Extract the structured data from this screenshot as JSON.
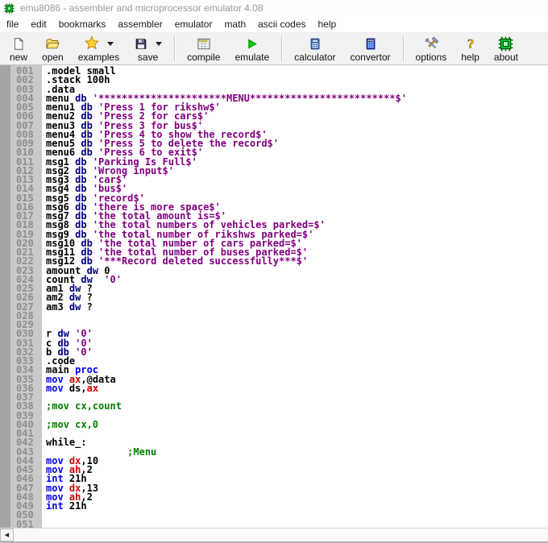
{
  "window": {
    "title": "emu8086 - assembler and microprocessor emulator 4.08",
    "app_icon": "chip-icon"
  },
  "menu_bar": {
    "items": [
      "file",
      "edit",
      "bookmarks",
      "assembler",
      "emulator",
      "math",
      "ascii codes",
      "help"
    ]
  },
  "toolbar": {
    "items": [
      {
        "type": "button",
        "name": "new",
        "label": "new",
        "icon": "new-document-icon"
      },
      {
        "type": "button",
        "name": "open",
        "label": "open",
        "icon": "open-folder-icon"
      },
      {
        "type": "button",
        "name": "examples",
        "label": "examples",
        "icon": "examples-star-icon",
        "dropdown": true
      },
      {
        "type": "button",
        "name": "save",
        "label": "save",
        "icon": "save-floppy-icon",
        "dropdown": true
      },
      {
        "type": "separator"
      },
      {
        "type": "button",
        "name": "compile",
        "label": "compile",
        "icon": "compile-icon"
      },
      {
        "type": "button",
        "name": "emulate",
        "label": "emulate",
        "icon": "emulate-play-icon"
      },
      {
        "type": "separator"
      },
      {
        "type": "button",
        "name": "calculator",
        "label": "calculator",
        "icon": "calculator-icon"
      },
      {
        "type": "button",
        "name": "convertor",
        "label": "convertor",
        "icon": "convertor-icon"
      },
      {
        "type": "separator"
      },
      {
        "type": "button",
        "name": "options",
        "label": "options",
        "icon": "options-tools-icon"
      },
      {
        "type": "button",
        "name": "help",
        "label": "help",
        "icon": "help-question-icon"
      },
      {
        "type": "button",
        "name": "about",
        "label": "about",
        "icon": "about-chip-icon"
      }
    ]
  },
  "syntax_colors": {
    "keyword": "#0000f0",
    "declaration": "#000080",
    "register": "#d40000",
    "string": "#800080",
    "comment": "#008000",
    "plain": "#000000"
  },
  "editor": {
    "lines": [
      {
        "tokens": [
          [
            "plain",
            ".model small"
          ]
        ]
      },
      {
        "tokens": [
          [
            "plain",
            ".stack 100h"
          ]
        ]
      },
      {
        "tokens": [
          [
            "plain",
            ".data"
          ]
        ]
      },
      {
        "tokens": [
          [
            "plain",
            "menu "
          ],
          [
            "decl",
            "db"
          ],
          [
            "plain",
            " "
          ],
          [
            "str",
            "'**********************MENU*************************$'"
          ]
        ]
      },
      {
        "tokens": [
          [
            "plain",
            "menu1 "
          ],
          [
            "decl",
            "db"
          ],
          [
            "plain",
            " "
          ],
          [
            "str",
            "'Press 1 for rikshw$'"
          ]
        ]
      },
      {
        "tokens": [
          [
            "plain",
            "menu2 "
          ],
          [
            "decl",
            "db"
          ],
          [
            "plain",
            " "
          ],
          [
            "str",
            "'Press 2 for cars$'"
          ]
        ]
      },
      {
        "tokens": [
          [
            "plain",
            "menu3 "
          ],
          [
            "decl",
            "db"
          ],
          [
            "plain",
            " "
          ],
          [
            "str",
            "'Press 3 for bus$'"
          ]
        ]
      },
      {
        "tokens": [
          [
            "plain",
            "menu4 "
          ],
          [
            "decl",
            "db"
          ],
          [
            "plain",
            " "
          ],
          [
            "str",
            "'Press 4 to show the record$'"
          ]
        ]
      },
      {
        "tokens": [
          [
            "plain",
            "menu5 "
          ],
          [
            "decl",
            "db"
          ],
          [
            "plain",
            " "
          ],
          [
            "str",
            "'Press 5 to delete the record$'"
          ]
        ]
      },
      {
        "tokens": [
          [
            "plain",
            "menu6 "
          ],
          [
            "decl",
            "db"
          ],
          [
            "plain",
            " "
          ],
          [
            "str",
            "'Press 6 to exit$'"
          ]
        ]
      },
      {
        "tokens": [
          [
            "plain",
            "msg1 "
          ],
          [
            "decl",
            "db"
          ],
          [
            "plain",
            " "
          ],
          [
            "str",
            "'Parking Is Full$'"
          ]
        ]
      },
      {
        "tokens": [
          [
            "plain",
            "msg2 "
          ],
          [
            "decl",
            "db"
          ],
          [
            "plain",
            " "
          ],
          [
            "str",
            "'Wrong input$'"
          ]
        ]
      },
      {
        "tokens": [
          [
            "plain",
            "msg3 "
          ],
          [
            "decl",
            "db"
          ],
          [
            "plain",
            " "
          ],
          [
            "str",
            "'car$'"
          ]
        ]
      },
      {
        "tokens": [
          [
            "plain",
            "msg4 "
          ],
          [
            "decl",
            "db"
          ],
          [
            "plain",
            " "
          ],
          [
            "str",
            "'bus$'"
          ]
        ]
      },
      {
        "tokens": [
          [
            "plain",
            "msg5 "
          ],
          [
            "decl",
            "db"
          ],
          [
            "plain",
            " "
          ],
          [
            "str",
            "'record$'"
          ]
        ]
      },
      {
        "tokens": [
          [
            "plain",
            "msg6 "
          ],
          [
            "decl",
            "db"
          ],
          [
            "plain",
            " "
          ],
          [
            "str",
            "'there is more space$'"
          ]
        ]
      },
      {
        "tokens": [
          [
            "plain",
            "msg7 "
          ],
          [
            "decl",
            "db"
          ],
          [
            "plain",
            " "
          ],
          [
            "str",
            "'the total amount is=$'"
          ]
        ]
      },
      {
        "tokens": [
          [
            "plain",
            "msg8 "
          ],
          [
            "decl",
            "db"
          ],
          [
            "plain",
            " "
          ],
          [
            "str",
            "'the total numbers of vehicles parked=$'"
          ]
        ]
      },
      {
        "tokens": [
          [
            "plain",
            "msg9 "
          ],
          [
            "decl",
            "db"
          ],
          [
            "plain",
            " "
          ],
          [
            "str",
            "'the total number of rikshws parked=$'"
          ]
        ]
      },
      {
        "tokens": [
          [
            "plain",
            "msg10 "
          ],
          [
            "decl",
            "db"
          ],
          [
            "plain",
            " "
          ],
          [
            "str",
            "'the total number of cars parked=$'"
          ]
        ]
      },
      {
        "tokens": [
          [
            "plain",
            "msg11 "
          ],
          [
            "decl",
            "db"
          ],
          [
            "plain",
            " "
          ],
          [
            "str",
            "'the total number of buses parked=$'"
          ]
        ]
      },
      {
        "tokens": [
          [
            "plain",
            "msg12 "
          ],
          [
            "decl",
            "db"
          ],
          [
            "plain",
            " "
          ],
          [
            "str",
            "'***Record deleted successfully***$'"
          ]
        ]
      },
      {
        "tokens": [
          [
            "plain",
            "amount "
          ],
          [
            "decl",
            "dw"
          ],
          [
            "plain",
            " 0"
          ]
        ]
      },
      {
        "tokens": [
          [
            "plain",
            "count "
          ],
          [
            "decl",
            "dw"
          ],
          [
            "plain",
            "  "
          ],
          [
            "str",
            "'0'"
          ]
        ]
      },
      {
        "tokens": [
          [
            "plain",
            "am1 "
          ],
          [
            "decl",
            "dw"
          ],
          [
            "plain",
            " ?"
          ]
        ]
      },
      {
        "tokens": [
          [
            "plain",
            "am2 "
          ],
          [
            "decl",
            "dw"
          ],
          [
            "plain",
            " ?"
          ]
        ]
      },
      {
        "tokens": [
          [
            "plain",
            "am3 "
          ],
          [
            "decl",
            "dw"
          ],
          [
            "plain",
            " ?"
          ]
        ]
      },
      {
        "tokens": []
      },
      {
        "tokens": []
      },
      {
        "tokens": [
          [
            "plain",
            "r "
          ],
          [
            "decl",
            "dw"
          ],
          [
            "plain",
            " "
          ],
          [
            "str",
            "'0'"
          ]
        ]
      },
      {
        "tokens": [
          [
            "plain",
            "c "
          ],
          [
            "decl",
            "db"
          ],
          [
            "plain",
            " "
          ],
          [
            "str",
            "'0'"
          ]
        ]
      },
      {
        "tokens": [
          [
            "plain",
            "b "
          ],
          [
            "decl",
            "db"
          ],
          [
            "plain",
            " "
          ],
          [
            "str",
            "'0'"
          ]
        ]
      },
      {
        "tokens": [
          [
            "plain",
            ".code"
          ]
        ]
      },
      {
        "tokens": [
          [
            "plain",
            "main "
          ],
          [
            "kw",
            "proc"
          ]
        ]
      },
      {
        "tokens": [
          [
            "kw",
            "mov"
          ],
          [
            "plain",
            " "
          ],
          [
            "reg",
            "ax"
          ],
          [
            "plain",
            ",@data"
          ]
        ]
      },
      {
        "tokens": [
          [
            "kw",
            "mov"
          ],
          [
            "plain",
            " ds,"
          ],
          [
            "reg",
            "ax"
          ]
        ]
      },
      {
        "tokens": []
      },
      {
        "tokens": [
          [
            "com",
            ";mov cx,count"
          ]
        ]
      },
      {
        "tokens": []
      },
      {
        "tokens": [
          [
            "com",
            ";mov cx,0"
          ]
        ]
      },
      {
        "tokens": []
      },
      {
        "tokens": [
          [
            "plain",
            "while_:"
          ]
        ]
      },
      {
        "tokens": [
          [
            "com",
            "              ;Menu"
          ]
        ]
      },
      {
        "tokens": [
          [
            "kw",
            "mov"
          ],
          [
            "plain",
            " "
          ],
          [
            "reg",
            "dx"
          ],
          [
            "plain",
            ",10"
          ]
        ]
      },
      {
        "tokens": [
          [
            "kw",
            "mov"
          ],
          [
            "plain",
            " "
          ],
          [
            "reg",
            "ah"
          ],
          [
            "plain",
            ",2"
          ]
        ]
      },
      {
        "tokens": [
          [
            "kw",
            "int"
          ],
          [
            "plain",
            " 21h"
          ]
        ]
      },
      {
        "tokens": [
          [
            "kw",
            "mov"
          ],
          [
            "plain",
            " "
          ],
          [
            "reg",
            "dx"
          ],
          [
            "plain",
            ",13"
          ]
        ]
      },
      {
        "tokens": [
          [
            "kw",
            "mov"
          ],
          [
            "plain",
            " "
          ],
          [
            "reg",
            "ah"
          ],
          [
            "plain",
            ",2"
          ]
        ]
      },
      {
        "tokens": [
          [
            "kw",
            "int"
          ],
          [
            "plain",
            " 21h"
          ]
        ]
      },
      {
        "tokens": []
      },
      {
        "tokens": []
      }
    ]
  },
  "scrollbar": {
    "left_arrow": "◀"
  }
}
